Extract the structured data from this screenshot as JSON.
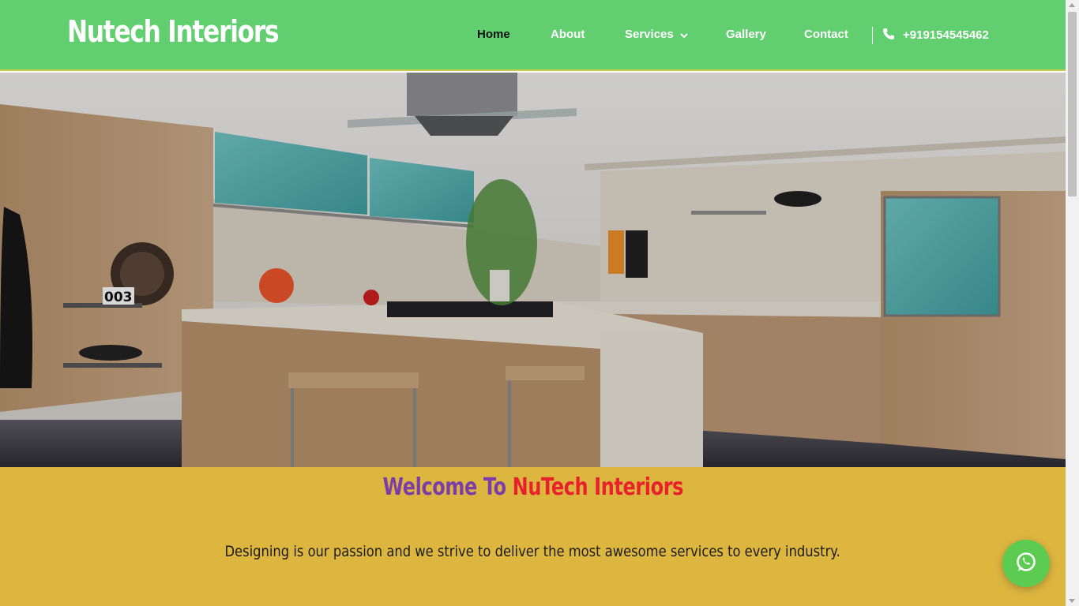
{
  "header": {
    "logo": "Nutech Interiors",
    "nav": {
      "home": "Home",
      "about": "About",
      "services": "Services",
      "gallery": "Gallery",
      "contact": "Contact",
      "phone": "+919154545462"
    },
    "active_item": "Home",
    "icons": [
      "chevron-down-icon",
      "phone-icon"
    ]
  },
  "hero": {
    "scene": "kitchen interior photo",
    "label_on_shelf": "003"
  },
  "welcome": {
    "title_part1": "Welcome To ",
    "title_part2": "NuTech Interiors",
    "tagline": "Designing is our passion and we strive to deliver the most awesome services to every industry."
  },
  "floating": {
    "icon": "whatsapp-icon"
  },
  "colors": {
    "header_bg": "#61cf70",
    "welcome_bg": "#ddb640",
    "title_purple": "#7b3ea8",
    "title_red": "#e8222b",
    "whatsapp_green": "#5ccb52"
  }
}
